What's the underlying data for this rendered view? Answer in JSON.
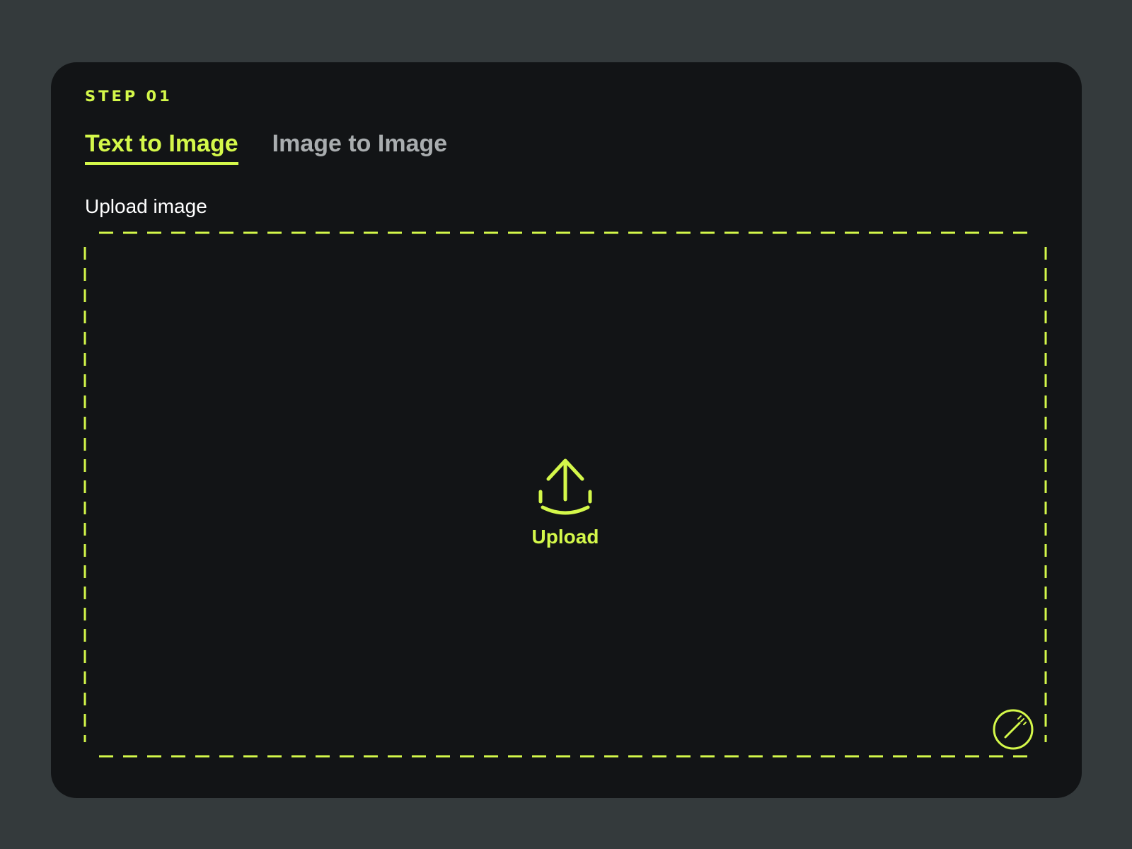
{
  "step_label": "STEP 01",
  "tabs": [
    {
      "label": "Text to Image",
      "active": true
    },
    {
      "label": "Image to Image",
      "active": false
    }
  ],
  "upload": {
    "label": "Upload image",
    "button_text": "Upload",
    "icon": "upload-icon",
    "corner_icon": "magic-wand-icon"
  },
  "colors": {
    "accent": "#d4f84a",
    "page_background": "#343a3c",
    "card_background": "#121416",
    "inactive_text": "#a9adaf",
    "label_text": "#ffffff"
  }
}
